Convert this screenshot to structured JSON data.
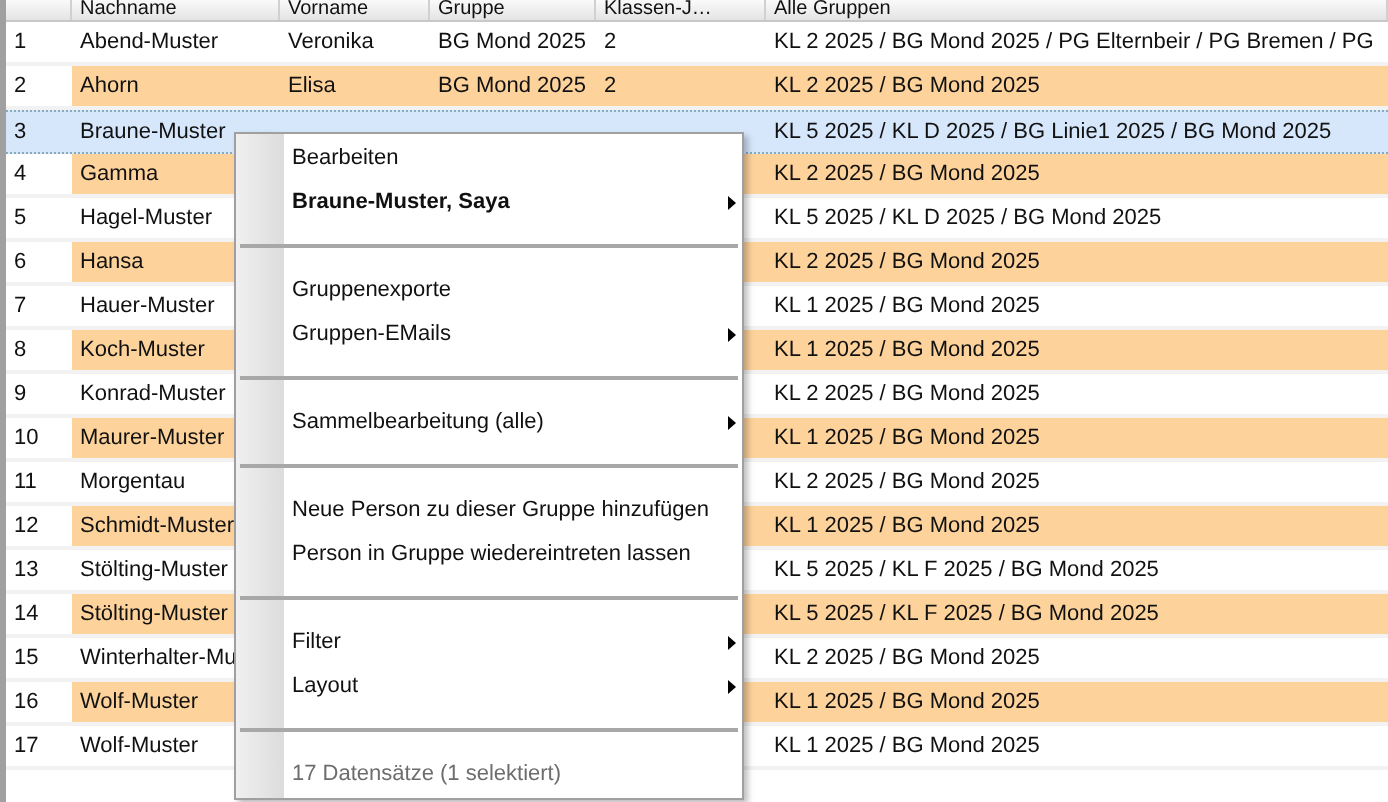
{
  "table": {
    "columns": [
      {},
      {
        "label": "Nachname"
      },
      {
        "label": "Vorname"
      },
      {
        "label": "Gruppe"
      },
      {
        "label": "Klassen-J…"
      },
      {
        "label": "Alle Gruppen"
      }
    ],
    "rows": [
      {
        "number": "1",
        "nachname": "Abend-Muster",
        "vorname": "Veronika",
        "gruppe": "BG Mond 2025",
        "klassen": "2",
        "alle_gruppen": "KL 2 2025 / BG Mond 2025 / PG Elternbeir / PG Bremen / PG",
        "selected": false
      },
      {
        "number": "2",
        "nachname": "Ahorn",
        "vorname": "Elisa",
        "gruppe": "BG Mond 2025",
        "klassen": "2",
        "alle_gruppen": "KL 2 2025 / BG Mond 2025",
        "selected": false
      },
      {
        "number": "3",
        "nachname": "Braune-Muster",
        "alle_gruppen": "KL 5 2025 / KL D 2025 / BG Linie1 2025 / BG Mond 2025",
        "selected": true
      },
      {
        "number": "4",
        "nachname": "Gamma",
        "alle_gruppen": "KL 2 2025 / BG Mond 2025",
        "selected": false
      },
      {
        "number": "5",
        "nachname": "Hagel-Muster",
        "alle_gruppen": "KL 5 2025 / KL D 2025 / BG Mond 2025",
        "selected": false
      },
      {
        "number": "6",
        "nachname": "Hansa",
        "alle_gruppen": "KL 2 2025 / BG Mond 2025",
        "selected": false
      },
      {
        "number": "7",
        "nachname": "Hauer-Muster",
        "alle_gruppen": "KL 1 2025 / BG Mond 2025",
        "selected": false
      },
      {
        "number": "8",
        "nachname": "Koch-Muster",
        "alle_gruppen": "KL 1 2025 / BG Mond 2025",
        "selected": false
      },
      {
        "number": "9",
        "nachname": "Konrad-Muster",
        "alle_gruppen": "KL 2 2025 / BG Mond 2025",
        "selected": false
      },
      {
        "number": "10",
        "nachname": "Maurer-Muster",
        "alle_gruppen": "KL 1 2025 / BG Mond 2025",
        "selected": false
      },
      {
        "number": "11",
        "nachname": "Morgentau",
        "alle_gruppen": "KL 2 2025 / BG Mond 2025",
        "selected": false
      },
      {
        "number": "12",
        "nachname": "Schmidt-Muster",
        "alle_gruppen": "KL 1 2025 / BG Mond 2025",
        "selected": false
      },
      {
        "number": "13",
        "nachname": "Stölting-Muster",
        "alle_gruppen": "KL 5 2025 / KL F 2025 / BG Mond 2025",
        "selected": false
      },
      {
        "number": "14",
        "nachname": "Stölting-Muster",
        "alle_gruppen": "KL 5 2025 / KL F 2025 / BG Mond 2025",
        "selected": false
      },
      {
        "number": "15",
        "nachname": "Winterhalter-Mu",
        "alle_gruppen": "KL 2 2025 / BG Mond 2025",
        "selected": false
      },
      {
        "number": "16",
        "nachname": "Wolf-Muster",
        "alle_gruppen": "KL 1 2025 / BG Mond 2025",
        "selected": false
      },
      {
        "number": "17",
        "nachname": "Wolf-Muster",
        "alle_gruppen": "KL 1 2025 / BG Mond 2025",
        "selected": false
      }
    ]
  },
  "context_menu": {
    "items": [
      {
        "kind": "item",
        "label": "Bearbeiten",
        "submenu": false,
        "bold": false,
        "disabled": false
      },
      {
        "kind": "item",
        "label": "Braune-Muster, Saya",
        "submenu": true,
        "bold": true,
        "disabled": false
      },
      {
        "kind": "separator"
      },
      {
        "kind": "item",
        "label": "Gruppenexporte",
        "submenu": false,
        "bold": false,
        "disabled": false
      },
      {
        "kind": "item",
        "label": "Gruppen-EMails",
        "submenu": true,
        "bold": false,
        "disabled": false
      },
      {
        "kind": "separator"
      },
      {
        "kind": "item",
        "label": "Sammelbearbeitung (alle)",
        "submenu": true,
        "bold": false,
        "disabled": false
      },
      {
        "kind": "separator"
      },
      {
        "kind": "item",
        "label": "Neue Person zu dieser Gruppe hinzufügen",
        "submenu": false,
        "bold": false,
        "disabled": false
      },
      {
        "kind": "item",
        "label": "Person in Gruppe wiedereintreten lassen",
        "submenu": false,
        "bold": false,
        "disabled": false
      },
      {
        "kind": "separator"
      },
      {
        "kind": "item",
        "label": "Filter",
        "submenu": true,
        "bold": false,
        "disabled": false
      },
      {
        "kind": "item",
        "label": "Layout",
        "submenu": true,
        "bold": false,
        "disabled": false
      },
      {
        "kind": "separator"
      },
      {
        "kind": "item",
        "label": "17 Datensätze (1 selektiert)",
        "submenu": false,
        "bold": false,
        "disabled": true
      }
    ]
  }
}
